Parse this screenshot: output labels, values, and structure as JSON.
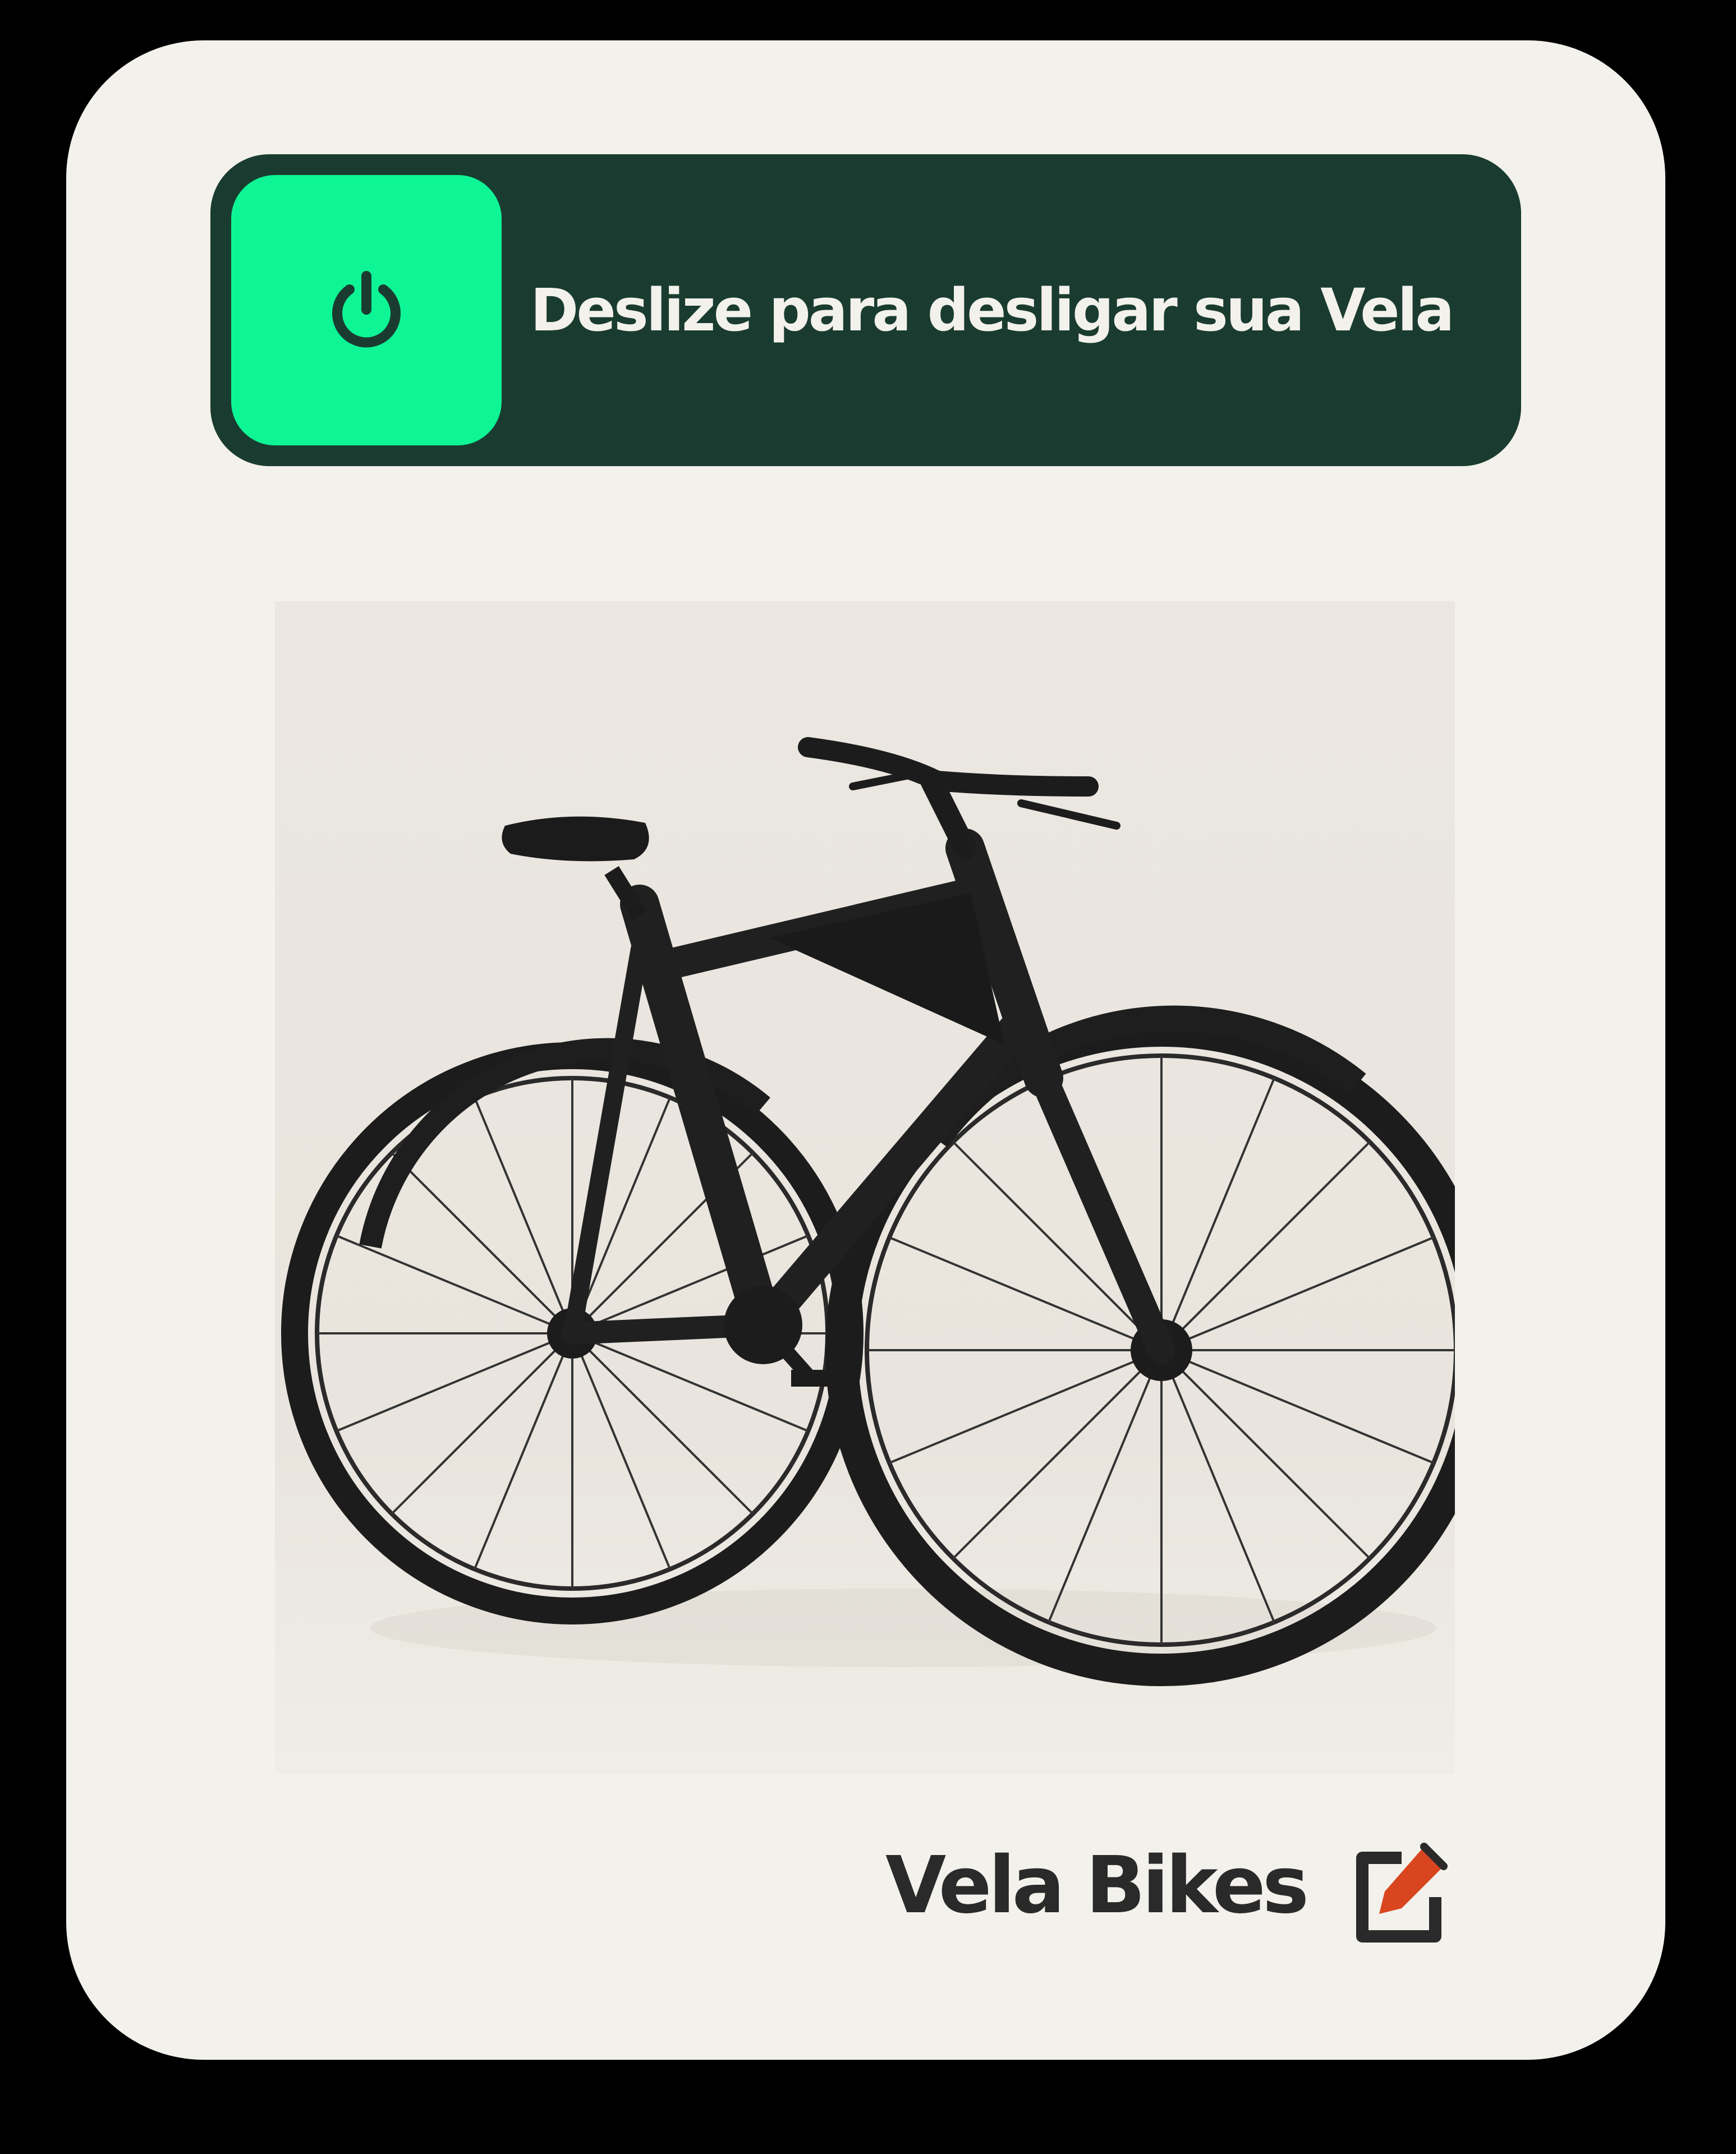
{
  "slider": {
    "label": "Deslize para desligar sua Vela",
    "handle_icon": "power-icon",
    "track_color": "#1a3c30",
    "handle_color": "#0ef596"
  },
  "product": {
    "image_subject": "black electric bicycle",
    "brand_label": "Vela Bikes",
    "edit_icon": "edit-icon",
    "edit_icon_accent": "#d9451f"
  },
  "colors": {
    "card_background": "#f3f1eb",
    "page_background": "#000000"
  }
}
